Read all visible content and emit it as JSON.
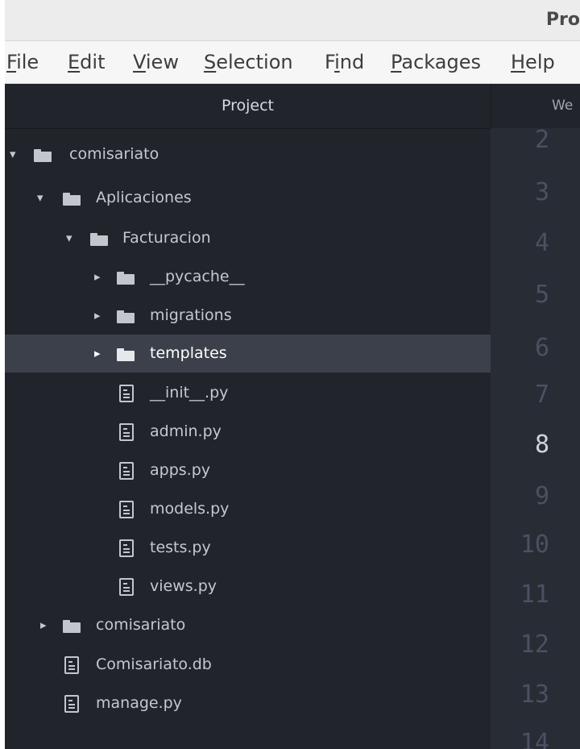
{
  "window": {
    "title": "Pro"
  },
  "menubar": {
    "items": [
      {
        "key": "F",
        "rest": "ile"
      },
      {
        "key": "E",
        "rest": "dit"
      },
      {
        "key": "V",
        "rest": "iew"
      },
      {
        "key": "S",
        "rest": "election"
      },
      {
        "pre": "F",
        "key": "i",
        "rest": "nd"
      },
      {
        "key": "P",
        "rest": "ackages"
      },
      {
        "key": "H",
        "rest": "elp"
      }
    ]
  },
  "sidebar": {
    "header": "Project",
    "tree": [
      {
        "label": "comisariato",
        "type": "folder",
        "expanded": true
      },
      {
        "label": "Aplicaciones",
        "type": "folder",
        "expanded": true
      },
      {
        "label": "Facturacion",
        "type": "folder",
        "expanded": true
      },
      {
        "label": "__pycache__",
        "type": "folder",
        "expanded": false
      },
      {
        "label": "migrations",
        "type": "folder",
        "expanded": false
      },
      {
        "label": "templates",
        "type": "folder",
        "expanded": false,
        "selected": true
      },
      {
        "label": "__init__.py",
        "type": "file"
      },
      {
        "label": "admin.py",
        "type": "file"
      },
      {
        "label": "apps.py",
        "type": "file"
      },
      {
        "label": "models.py",
        "type": "file"
      },
      {
        "label": "tests.py",
        "type": "file"
      },
      {
        "label": "views.py",
        "type": "file"
      },
      {
        "label": "comisariato",
        "type": "folder",
        "expanded": false
      },
      {
        "label": "Comisariato.db",
        "type": "file"
      },
      {
        "label": "manage.py",
        "type": "file"
      }
    ]
  },
  "editor": {
    "tab_label": "We",
    "line_numbers": [
      "2",
      "3",
      "4",
      "5",
      "6",
      "7",
      "8",
      "9",
      "10",
      "11",
      "12",
      "13",
      "14"
    ],
    "active_line": "8"
  },
  "colors": {
    "sidebar_bg": "#21252b",
    "editor_bg": "#282c34",
    "selection_bg": "#3b404a"
  }
}
